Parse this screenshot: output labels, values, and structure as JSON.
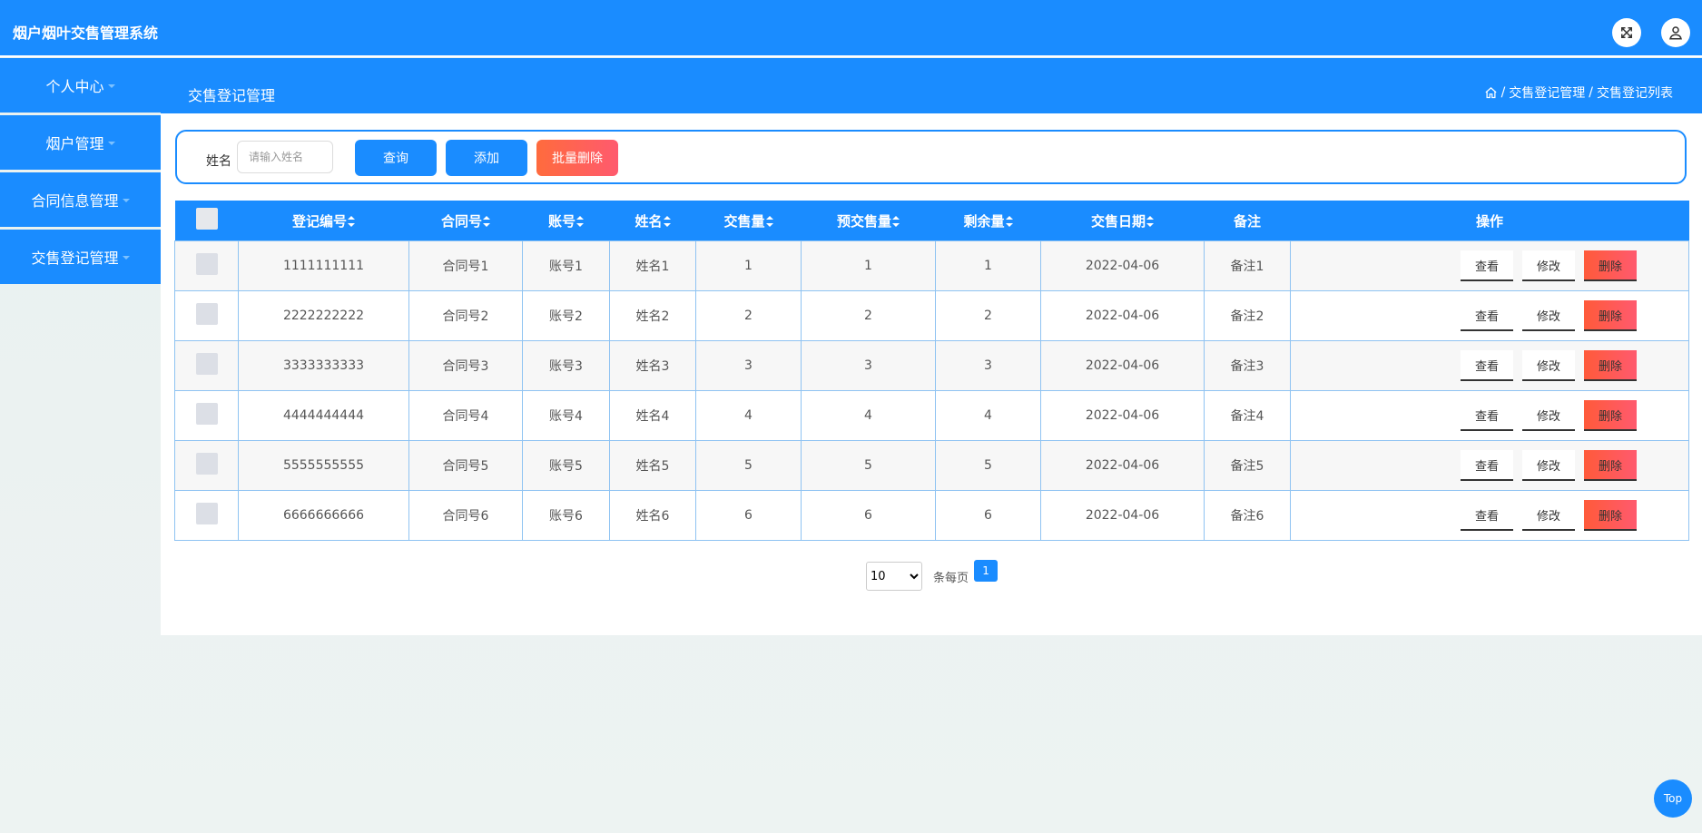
{
  "app": {
    "title": "烟户烟叶交售管理系统"
  },
  "header_icons": [
    "fullscreen-icon",
    "user-icon"
  ],
  "sidebar": {
    "items": [
      {
        "label": "个人中心"
      },
      {
        "label": "烟户管理"
      },
      {
        "label": "合同信息管理"
      },
      {
        "label": "交售登记管理"
      }
    ]
  },
  "subheader": {
    "title": "交售登记管理",
    "breadcrumb": [
      "交售登记管理",
      "交售登记列表"
    ]
  },
  "search": {
    "label": "姓名",
    "placeholder": "请输入姓名",
    "query_label": "查询",
    "add_label": "添加",
    "batch_delete_label": "批量删除"
  },
  "table": {
    "headers": [
      "登记编号",
      "合同号",
      "账号",
      "姓名",
      "交售量",
      "预交售量",
      "剩余量",
      "交售日期",
      "备注",
      "操作"
    ],
    "rows": [
      [
        "1111111111",
        "合同号1",
        "账号1",
        "姓名1",
        "1",
        "1",
        "1",
        "2022-04-06",
        "备注1"
      ],
      [
        "2222222222",
        "合同号2",
        "账号2",
        "姓名2",
        "2",
        "2",
        "2",
        "2022-04-06",
        "备注2"
      ],
      [
        "3333333333",
        "合同号3",
        "账号3",
        "姓名3",
        "3",
        "3",
        "3",
        "2022-04-06",
        "备注3"
      ],
      [
        "4444444444",
        "合同号4",
        "账号4",
        "姓名4",
        "4",
        "4",
        "4",
        "2022-04-06",
        "备注4"
      ],
      [
        "5555555555",
        "合同号5",
        "账号5",
        "姓名5",
        "5",
        "5",
        "5",
        "2022-04-06",
        "备注5"
      ],
      [
        "6666666666",
        "合同号6",
        "账号6",
        "姓名6",
        "6",
        "6",
        "6",
        "2022-04-06",
        "备注6"
      ]
    ],
    "actions": {
      "view": "查看",
      "edit": "修改",
      "delete": "删除"
    }
  },
  "pagination": {
    "page_size": "10",
    "page_size_suffix": "条每页",
    "current_page": "1"
  },
  "back_to_top": "Top",
  "colors": {
    "primary": "#1a8cff",
    "danger": "#ff5a5f"
  }
}
